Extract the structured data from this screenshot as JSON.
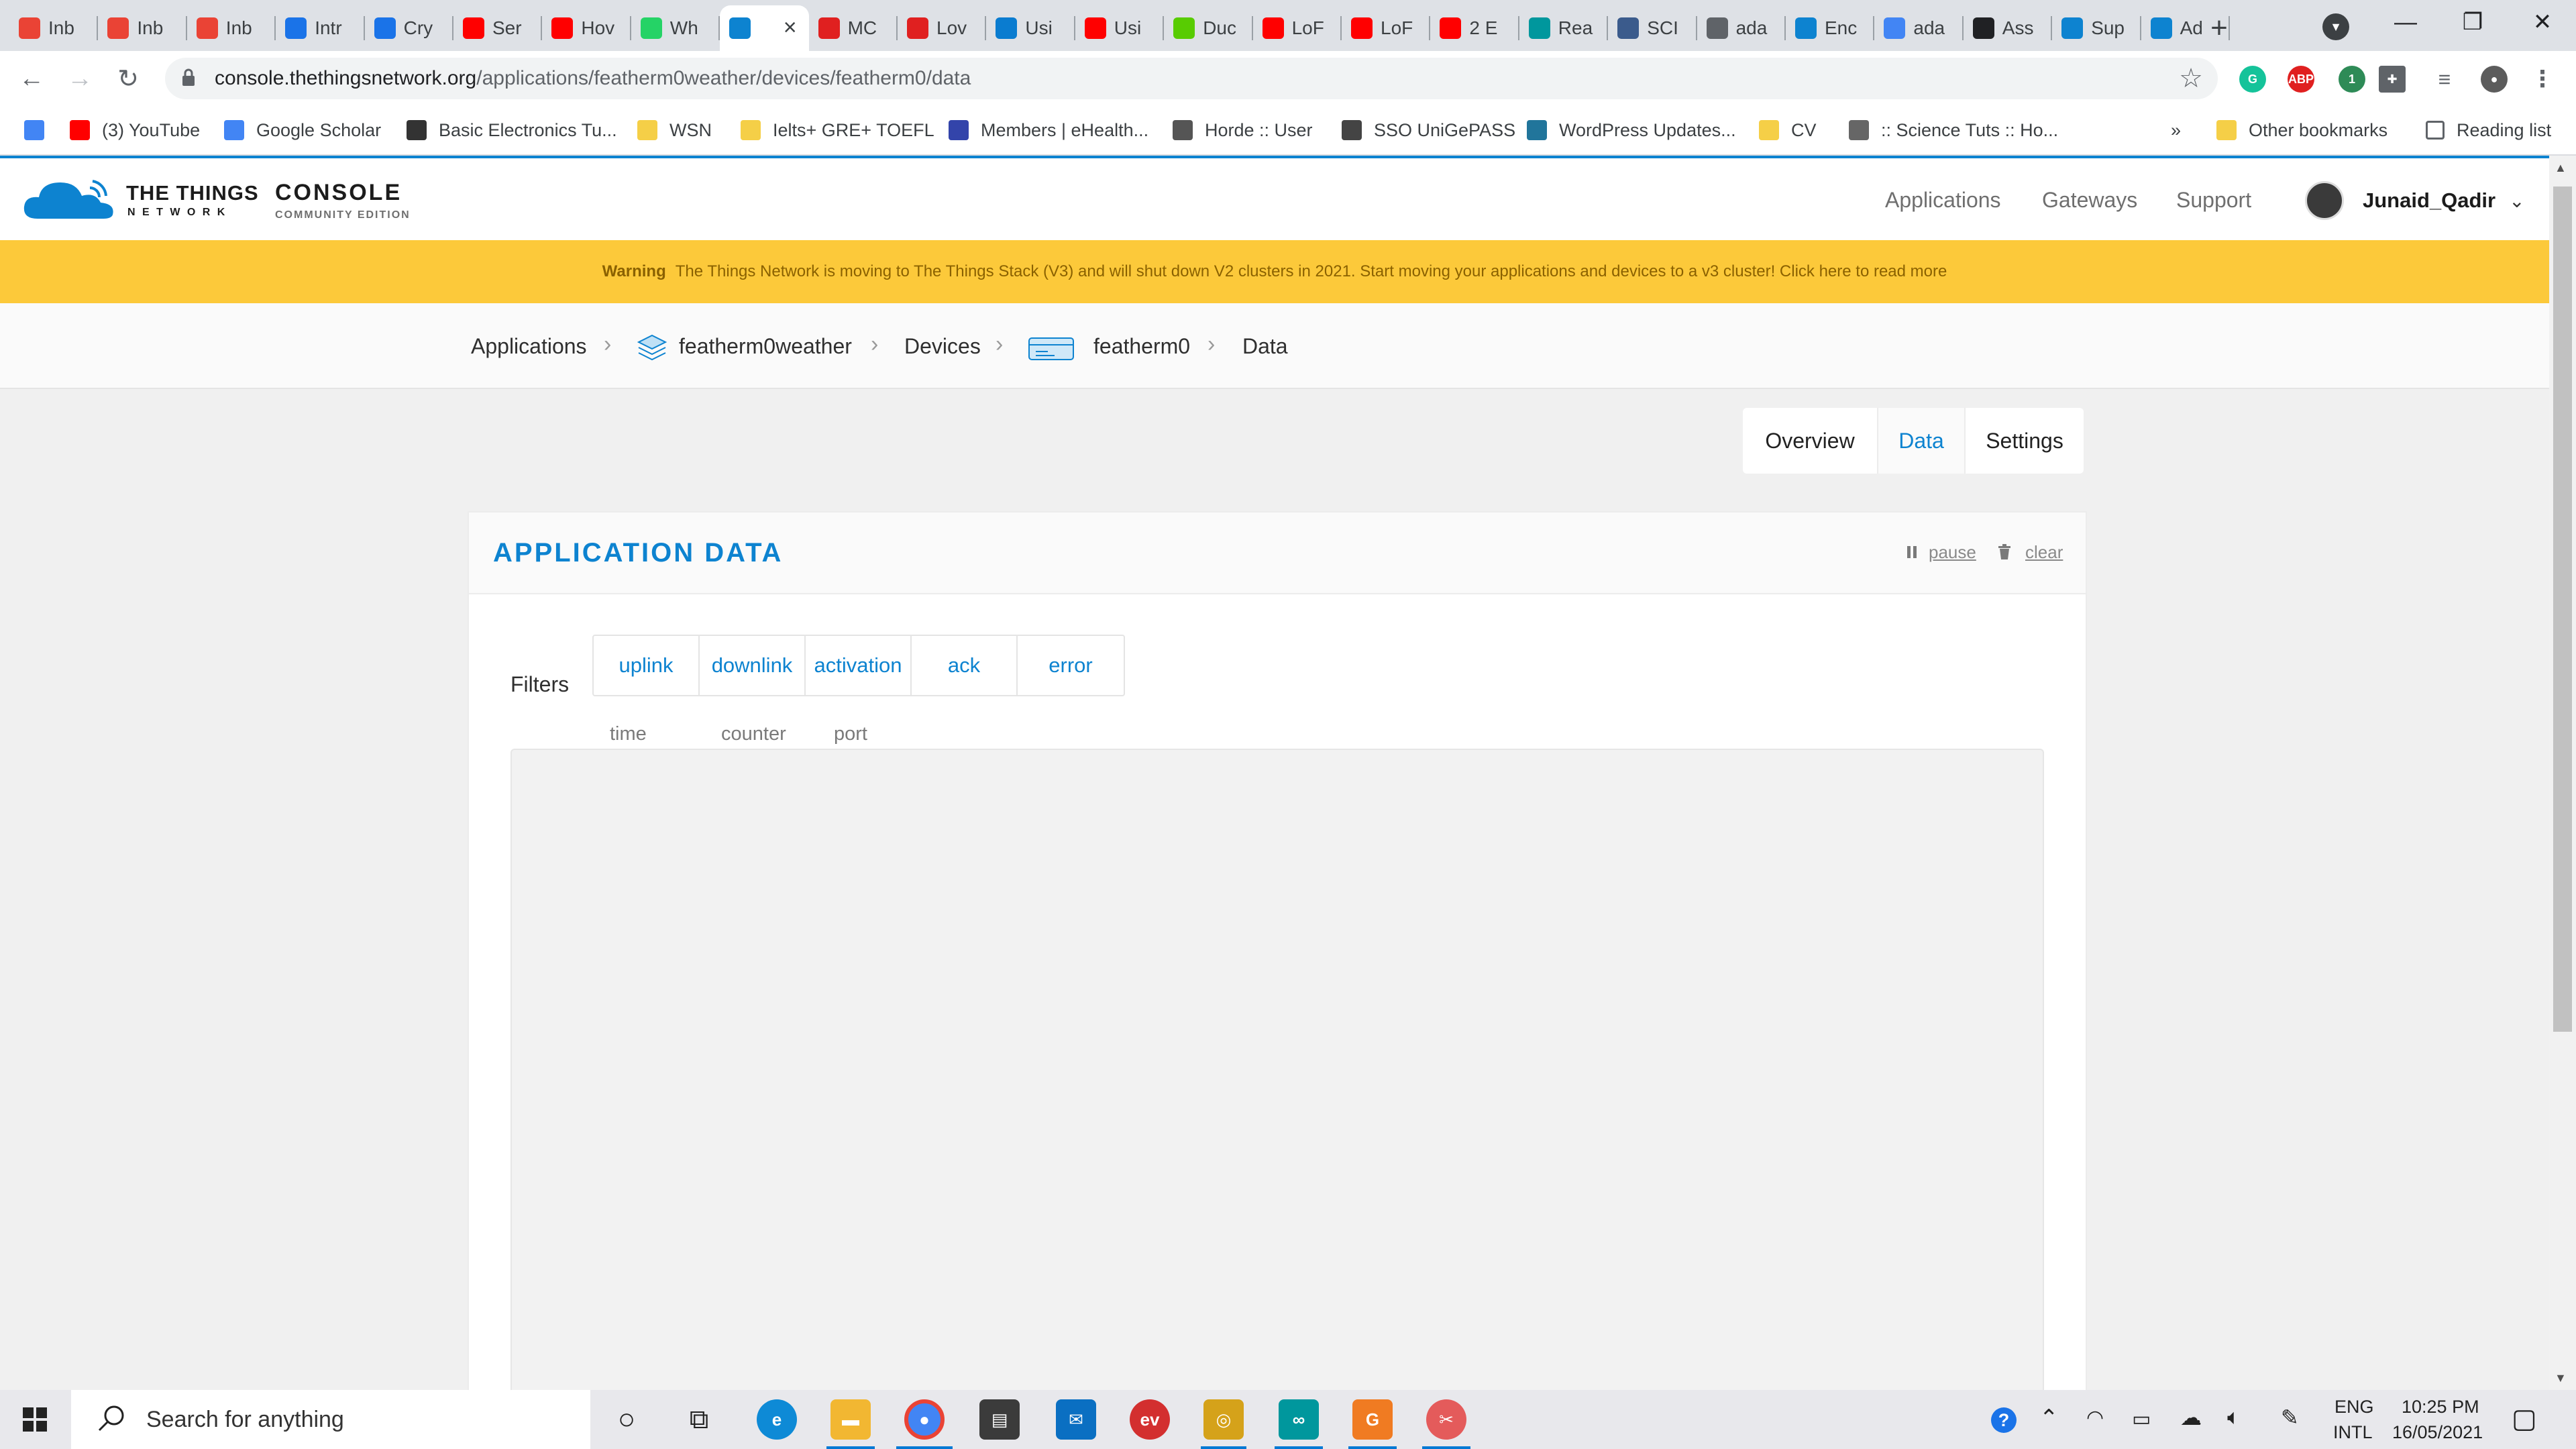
{
  "browser": {
    "tabs": [
      {
        "label": "Inb",
        "icon": "gmail-icon",
        "color": "#ea4335"
      },
      {
        "label": "Inb",
        "icon": "gmail-icon",
        "color": "#ea4335"
      },
      {
        "label": "Inb",
        "icon": "gmail-icon",
        "color": "#ea4335"
      },
      {
        "label": "Intr",
        "icon": "c-icon",
        "color": "#1a73e8"
      },
      {
        "label": "Cry",
        "icon": "c-icon",
        "color": "#1a73e8"
      },
      {
        "label": "Ser",
        "icon": "youtube-icon",
        "color": "#ff0000"
      },
      {
        "label": "Hov",
        "icon": "youtube-icon",
        "color": "#ff0000"
      },
      {
        "label": "Wh",
        "icon": "whatsapp-icon",
        "color": "#25d366"
      },
      {
        "label": "",
        "icon": "ttn-cloud-icon",
        "color": "#0d83d0",
        "active": true
      },
      {
        "label": "MC",
        "icon": "microchip-icon",
        "color": "#e02020"
      },
      {
        "label": "Lov",
        "icon": "microchip-icon",
        "color": "#e02020"
      },
      {
        "label": "Usi",
        "icon": "vscode-icon",
        "color": "#0a7cd0"
      },
      {
        "label": "Usi",
        "icon": "youtube-icon",
        "color": "#ff0000"
      },
      {
        "label": "Duc",
        "icon": "duolingo-icon",
        "color": "#58cc02"
      },
      {
        "label": "LoF",
        "icon": "youtube-icon",
        "color": "#ff0000"
      },
      {
        "label": "LoF",
        "icon": "youtube-icon",
        "color": "#ff0000"
      },
      {
        "label": "2 E",
        "icon": "youtube-icon",
        "color": "#ff0000"
      },
      {
        "label": "Rea",
        "icon": "arduino-icon",
        "color": "#00979d"
      },
      {
        "label": "SCI",
        "icon": "sci-icon",
        "color": "#3b5b8c"
      },
      {
        "label": "ada",
        "icon": "globe-icon",
        "color": "#5f6368"
      },
      {
        "label": "Enc",
        "icon": "ttn-cloud-icon",
        "color": "#0d83d0"
      },
      {
        "label": "ada",
        "icon": "google-icon",
        "color": "#4285f4"
      },
      {
        "label": "Ass",
        "icon": "star-icon",
        "color": "#202124"
      },
      {
        "label": "Sup",
        "icon": "ttn-cloud-icon",
        "color": "#0d83d0"
      },
      {
        "label": "Ad",
        "icon": "ttn-cloud-icon",
        "color": "#0d83d0"
      }
    ],
    "url_host": "console.thethingsnetwork.org",
    "url_path": "/applications/featherm0weather/devices/featherm0/data",
    "extensions": [
      {
        "label": "G",
        "color": "#15c39a"
      },
      {
        "label": "ABP",
        "color": "#e02020"
      },
      {
        "label": "1",
        "color": "#2e8b57"
      }
    ],
    "bookmarks": [
      {
        "label": "",
        "icon": "google-icon"
      },
      {
        "label": "(3) YouTube",
        "icon": "youtube-icon"
      },
      {
        "label": "Google Scholar",
        "icon": "scholar-icon"
      },
      {
        "label": "Basic Electronics Tu...",
        "icon": "shield-icon"
      },
      {
        "label": "WSN",
        "icon": "folder-icon"
      },
      {
        "label": "Ielts+ GRE+ TOEFL",
        "icon": "folder-icon"
      },
      {
        "label": "Members | eHealth...",
        "icon": "ehealth-icon"
      },
      {
        "label": "Horde :: User",
        "icon": "horde-icon"
      },
      {
        "label": "SSO UniGePASS",
        "icon": "crest-icon"
      },
      {
        "label": "WordPress Updates...",
        "icon": "wordpress-icon"
      },
      {
        "label": "CV",
        "icon": "folder-icon"
      },
      {
        "label": ":: Science Tuts :: Ho...",
        "icon": "info-icon"
      }
    ],
    "more": "»",
    "other_bookmarks": "Other bookmarks",
    "reading_list": "Reading list"
  },
  "ttn": {
    "brand_line1": "THE THINGS",
    "brand_line2": "N E T W O R K",
    "console_title": "CONSOLE",
    "console_sub": "COMMUNITY EDITION",
    "nav": [
      "Applications",
      "Gateways",
      "Support"
    ],
    "user": "Junaid_Qadir",
    "warning_label": "Warning",
    "warning_text": "The Things Network is moving to The Things Stack (V3) and will shut down V2 clusters in 2021. Start moving your applications and devices to a v3 cluster! Click here to read more",
    "breadcrumb": [
      "Applications",
      "featherm0weather",
      "Devices",
      "featherm0",
      "Data"
    ],
    "tabs": [
      "Overview",
      "Data",
      "Settings"
    ],
    "active_tab": "Data",
    "panel_title": "APPLICATION DATA",
    "pause": "pause",
    "clear": "clear",
    "filters_label": "Filters",
    "filters": [
      "uplink",
      "downlink",
      "activation",
      "ack",
      "error"
    ],
    "columns": [
      "time",
      "counter",
      "port"
    ]
  },
  "taskbar": {
    "search_placeholder": "Search for anything",
    "lang1": "ENG",
    "lang2": "INTL",
    "time": "10:25 PM",
    "date": "16/05/2021"
  }
}
